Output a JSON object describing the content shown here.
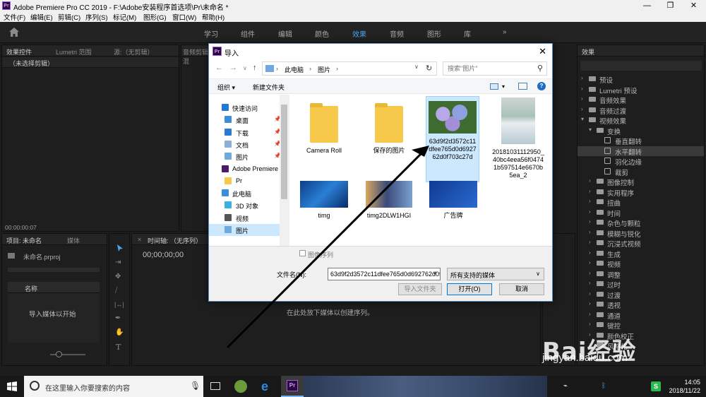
{
  "app": {
    "title": "Adobe Premiere Pro CC 2019 - F:\\Adobe安装程序首选项\\Pr\\未命名 *",
    "logo": "Pr",
    "window_buttons": [
      "—",
      "❐",
      "✕"
    ]
  },
  "menu": [
    "文件(F)",
    "编辑(E)",
    "剪辑(C)",
    "序列(S)",
    "标记(M)",
    "图形(G)",
    "窗口(W)",
    "帮助(H)"
  ],
  "workspaces": [
    {
      "label": "学习",
      "active": false
    },
    {
      "label": "组件",
      "active": false
    },
    {
      "label": "编辑",
      "active": false
    },
    {
      "label": "颜色",
      "active": false
    },
    {
      "label": "效果",
      "active": true
    },
    {
      "label": "音频",
      "active": false
    },
    {
      "label": "图形",
      "active": false
    },
    {
      "label": "库",
      "active": false
    }
  ],
  "workspace_more": "»",
  "left_panel": {
    "tabs": [
      "效果控件",
      "Lumetri 范围",
      "源:（无剪辑）",
      "音频剪辑混"
    ],
    "subhead": "（未选择剪辑）",
    "timecode": "00:00:00:07"
  },
  "project_panel": {
    "tabs": [
      "项目: 未命名",
      "媒体"
    ],
    "file": "未命名.prproj",
    "column_name": "名称",
    "empty_text": "导入媒体以开始"
  },
  "timeline_panel": {
    "tab": "时间轴: （无序列）",
    "timecode": "00;00;00;00",
    "empty_text": "在此处放下媒体以创建序列。"
  },
  "effects_panel": {
    "title": "效果",
    "items": [
      {
        "label": "预设",
        "kind": "folder",
        "level": 0,
        "expanded": false
      },
      {
        "label": "Lumetri 预设",
        "kind": "folder",
        "level": 0,
        "expanded": false
      },
      {
        "label": "音频效果",
        "kind": "folder",
        "level": 0,
        "expanded": false
      },
      {
        "label": "音频过渡",
        "kind": "folder",
        "level": 0,
        "expanded": false
      },
      {
        "label": "视频效果",
        "kind": "folder",
        "level": 0,
        "expanded": true
      },
      {
        "label": "变换",
        "kind": "folder",
        "level": 1,
        "expanded": true
      },
      {
        "label": "垂直翻转",
        "kind": "fx",
        "level": 2
      },
      {
        "label": "水平翻转",
        "kind": "fx",
        "level": 2,
        "selected": true
      },
      {
        "label": "羽化边缘",
        "kind": "fx",
        "level": 2
      },
      {
        "label": "裁剪",
        "kind": "fx",
        "level": 2
      },
      {
        "label": "图像控制",
        "kind": "folder",
        "level": 1
      },
      {
        "label": "实用程序",
        "kind": "folder",
        "level": 1
      },
      {
        "label": "扭曲",
        "kind": "folder",
        "level": 1
      },
      {
        "label": "时间",
        "kind": "folder",
        "level": 1
      },
      {
        "label": "杂色与颗粒",
        "kind": "folder",
        "level": 1
      },
      {
        "label": "模糊与锐化",
        "kind": "folder",
        "level": 1
      },
      {
        "label": "沉浸式视频",
        "kind": "folder",
        "level": 1
      },
      {
        "label": "生成",
        "kind": "folder",
        "level": 1
      },
      {
        "label": "视频",
        "kind": "folder",
        "level": 1
      },
      {
        "label": "调整",
        "kind": "folder",
        "level": 1
      },
      {
        "label": "过时",
        "kind": "folder",
        "level": 1
      },
      {
        "label": "过渡",
        "kind": "folder",
        "level": 1
      },
      {
        "label": "透视",
        "kind": "folder",
        "level": 1
      },
      {
        "label": "通道",
        "kind": "folder",
        "level": 1
      },
      {
        "label": "键控",
        "kind": "folder",
        "level": 1
      },
      {
        "label": "颜色校正",
        "kind": "folder",
        "level": 1
      },
      {
        "label": "风格化",
        "kind": "folder",
        "level": 1
      }
    ]
  },
  "dialog": {
    "title": "导入",
    "breadcrumb": [
      "此电脑",
      "图片"
    ],
    "search_placeholder": "搜索\"图片\"",
    "organize": "组织 ▾",
    "new_folder": "新建文件夹",
    "nav": [
      {
        "label": "快速访问",
        "icon": "star-icon",
        "color": "#1e7ad6",
        "pin": false,
        "header": true
      },
      {
        "label": "桌面",
        "icon": "desktop-icon",
        "color": "#3a8fd8",
        "pin": true
      },
      {
        "label": "下载",
        "icon": "download-icon",
        "color": "#2a7ad0",
        "pin": true
      },
      {
        "label": "文档",
        "icon": "document-icon",
        "color": "#8ab0d8",
        "pin": true
      },
      {
        "label": "图片",
        "icon": "pictures-icon",
        "color": "#6fa8dc",
        "pin": true
      },
      {
        "label": "Adobe Premiere",
        "icon": "premiere-icon",
        "color": "#4b1a6b",
        "pin": false,
        "header": true
      },
      {
        "label": "Pr",
        "icon": "folder-icon",
        "color": "#f6c94a",
        "pin": false
      },
      {
        "label": "此电脑",
        "icon": "computer-icon",
        "color": "#3a8fd8",
        "pin": false,
        "header": true
      },
      {
        "label": "3D 对象",
        "icon": "3d-objects-icon",
        "color": "#3ab0e0",
        "pin": false
      },
      {
        "label": "视频",
        "icon": "video-icon",
        "color": "#555",
        "pin": false
      },
      {
        "label": "图片",
        "icon": "pictures-icon",
        "color": "#6fa8dc",
        "pin": false,
        "selected": true
      }
    ],
    "files": [
      {
        "name": "Camera Roll",
        "type": "folder"
      },
      {
        "name": "保存的图片",
        "type": "folder"
      },
      {
        "name": "63d9f2d3572c11dfee765d0d692762d0f703c27d",
        "type": "image-hydrangea",
        "selected": true
      },
      {
        "name": "20181031112950_40bc4eea56f04741b597514e6670b5ea_2",
        "type": "image-portrait"
      },
      {
        "name": "timg",
        "type": "image-blue"
      },
      {
        "name": "timg2DLW1HGI",
        "type": "image-anime"
      },
      {
        "name": "广告牌",
        "type": "image-ad"
      }
    ],
    "sequence_checkbox": "图像序列",
    "filename_label": "文件名(N):",
    "filename_value": "63d9f2d3572c11dfee765d0d692762d0f7",
    "filetype": "所有支持的媒体",
    "import_folder_btn": "导入文件夹",
    "open_btn": "打开(O)",
    "cancel_btn": "取消"
  },
  "taskbar": {
    "search_placeholder": "在这里输入你要搜索的内容",
    "time": "14:05",
    "date": "2018/11/22"
  },
  "watermark": {
    "brand": "Bai经验",
    "url": "jingyan.baidu.com"
  },
  "colors": {
    "accent": "#4aa6f0",
    "selection": "#cce8ff"
  }
}
